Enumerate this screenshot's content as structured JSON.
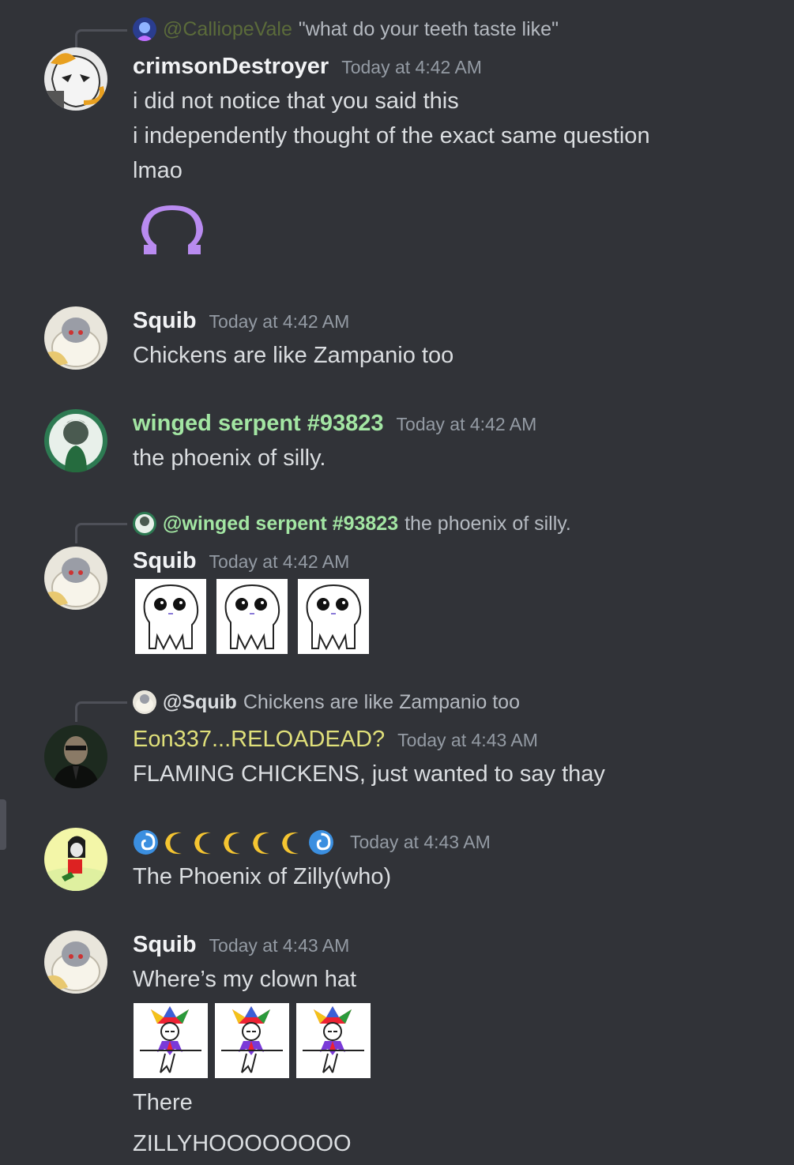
{
  "messages": {
    "m1": {
      "reply": {
        "author": "@CalliopeVale",
        "text": "\"what do your teeth taste like\""
      },
      "author": "crimsonDestroyer",
      "timestamp": "Today at 4:42 AM",
      "lines": [
        "i did not notice that you said this",
        "i independently thought of the exact same question",
        "lmao"
      ],
      "sticker": "omega-sticker"
    },
    "m2": {
      "author": "Squib",
      "timestamp": "Today at 4:42 AM",
      "lines": [
        "Chickens are like Zampanio too"
      ]
    },
    "m3": {
      "author": "winged serpent #93823",
      "author_color": "#a3e6a3",
      "timestamp": "Today at 4:42 AM",
      "lines": [
        "the phoenix of silly."
      ]
    },
    "m4": {
      "reply": {
        "author": "@winged serpent #93823",
        "text": "the phoenix of silly."
      },
      "reply_author_color": "#a3e6a3",
      "author": "Squib",
      "timestamp": "Today at 4:42 AM",
      "images": [
        "creature-emoji",
        "creature-emoji",
        "creature-emoji"
      ]
    },
    "m5": {
      "reply": {
        "author": "@Squib",
        "text": "Chickens are like Zampanio too"
      },
      "author": "Eon337...RELOADEAD?",
      "author_color": "#e0e07a",
      "timestamp": "Today at 4:43 AM",
      "lines": [
        "FLAMING CHICKENS, just wanted to say thay"
      ]
    },
    "m6": {
      "author_icons": [
        "cyclone-icon",
        "crescent-moon-icon",
        "crescent-moon-icon",
        "crescent-moon-icon",
        "crescent-moon-icon",
        "crescent-moon-icon",
        "cyclone-icon"
      ],
      "timestamp": "Today at 4:43 AM",
      "lines": [
        "The Phoenix of Zilly(who)"
      ]
    },
    "m7": {
      "author": "Squib",
      "timestamp": "Today at 4:43 AM",
      "lines": [
        "Where’s my clown hat",
        "There",
        "ZILLYHOOOOOOOO"
      ],
      "images": [
        "jester-emoji",
        "jester-emoji",
        "jester-emoji"
      ]
    }
  },
  "colors": {
    "background": "#313338",
    "text": "#dbdee1",
    "muted": "#949ba4",
    "sticker_purple": "#b98bf0"
  }
}
